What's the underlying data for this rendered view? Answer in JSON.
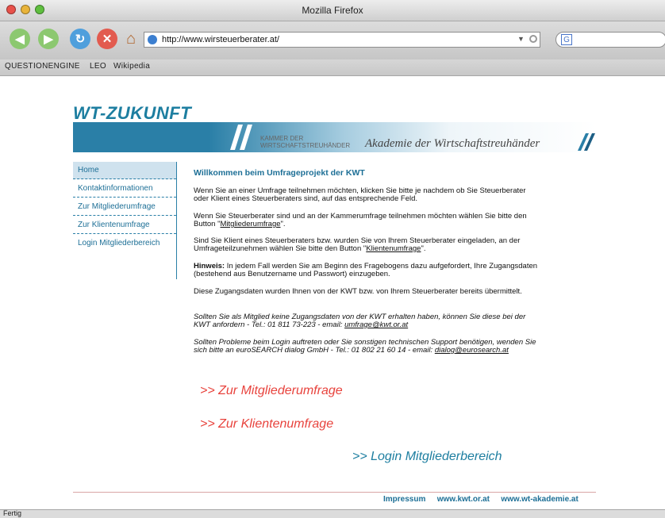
{
  "window": {
    "title": "Mozilla Firefox"
  },
  "toolbar": {
    "url": "http://www.wirsteuerberater.at/",
    "search_engine": "G"
  },
  "bookmarks": [
    "QUESTIONENGINE",
    "LEO",
    "Wikipedia"
  ],
  "status": "Fertig",
  "site": {
    "logo": "WT-ZUKUNFT",
    "kammer_line1": "KAMMER DER",
    "kammer_line2": "WIRTSCHAFTSTREUHÄNDER",
    "akademie": "Akademie der Wirtschaftstreuhänder"
  },
  "nav": [
    "Home",
    "Kontaktinformationen",
    "Zur Mitgliederumfrage",
    "Zur Klientenumfrage",
    "Login Mitgliederbereich"
  ],
  "content": {
    "heading": "Willkommen beim Umfrageprojekt der KWT",
    "p1": "Wenn Sie an einer Umfrage teilnehmen möchten, klicken Sie bitte je nachdem ob Sie Steuerberater oder Klient eines Steuerberaters sind, auf das entsprechende Feld.",
    "p2_pre": "Wenn Sie Steuerberater sind und an der Kammerumfrage teilnehmen möchten wählen Sie bitte den Button \"",
    "p2_link": "Mitgliederumfrage",
    "p2_post": "\".",
    "p3_pre": "Sind Sie Klient eines Steuerberaters bzw. wurden Sie von Ihrem Steuerberater eingeladen, an der Umfrageteilzunehmen wählen Sie bitte den Button \"",
    "p3_link": "Klientenumfrage",
    "p3_post": "\".",
    "p4_bold": "Hinweis:",
    "p4_rest": " In jedem Fall werden Sie am Beginn des Fragebogens dazu aufgefordert, Ihre Zugangsdaten (bestehend aus Benutzername und Passwort) einzugeben.",
    "p5": "Diese Zugangsdaten wurden Ihnen von der KWT bzw. von Ihrem Steuerberater bereits übermittelt.",
    "p6_pre": "Sollten Sie als Mitglied keine Zugangsdaten von der KWT erhalten haben, können Sie diese bei der KWT anfordern - Tel.: 01 811 73-223 - email: ",
    "p6_link": "umfrage@kwt.or.at",
    "p7_pre": "Sollten Probleme beim Login auftreten oder Sie sonstigen technischen Support benötigen, wenden Sie sich bitte an euroSEARCH dialog GmbH - Tel.: 01 802 21 60 14 - email: ",
    "p7_link": "dialog@eurosearch.at",
    "link_mitglieder": ">> Zur Mitgliederumfrage",
    "link_klienten": ">> Zur Klientenumfrage",
    "link_login": ">> Login Mitgliederbereich"
  },
  "footer": {
    "impressum": "Impressum",
    "site1": "www.kwt.or.at",
    "site2": "www.wt-akademie.at"
  },
  "colors": {
    "accent": "#1d6f96",
    "link_red": "#e8433d",
    "banner": "#2a7fa7"
  }
}
